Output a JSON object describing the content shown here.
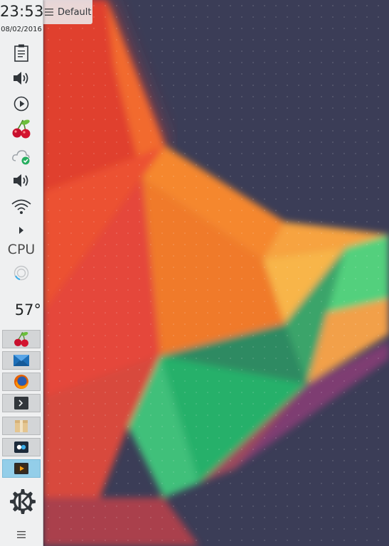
{
  "clock": {
    "time": "23:53",
    "date": "08/02/2016"
  },
  "system_tray": {
    "icons": [
      "clipboard-icon",
      "volume-icon",
      "media-player-icon",
      "cherry-icon",
      "cloud-sync-icon",
      "volume-icon",
      "wifi-icon",
      "expand-arrow-icon"
    ]
  },
  "cpu_widget": {
    "label": "CPU"
  },
  "weather": {
    "temperature": "57°"
  },
  "taskbar": {
    "tasks": [
      {
        "icon": "cherry-icon",
        "active": false
      },
      {
        "icon": "mail-icon",
        "active": false
      },
      {
        "icon": "firefox-icon",
        "active": false
      },
      {
        "icon": "terminal-icon",
        "active": false
      },
      {
        "icon": "package-icon",
        "active": false
      },
      {
        "icon": "system-settings-icon",
        "active": false
      },
      {
        "icon": "video-player-icon",
        "active": true
      }
    ]
  },
  "launcher": {
    "icon": "kde-logo-icon"
  },
  "desktop": {
    "toolbox_label": "Default"
  },
  "colors": {
    "panel": "#eff0f1",
    "active_task": "#93cee9",
    "wallpaper_bg": "#3b3d57"
  }
}
